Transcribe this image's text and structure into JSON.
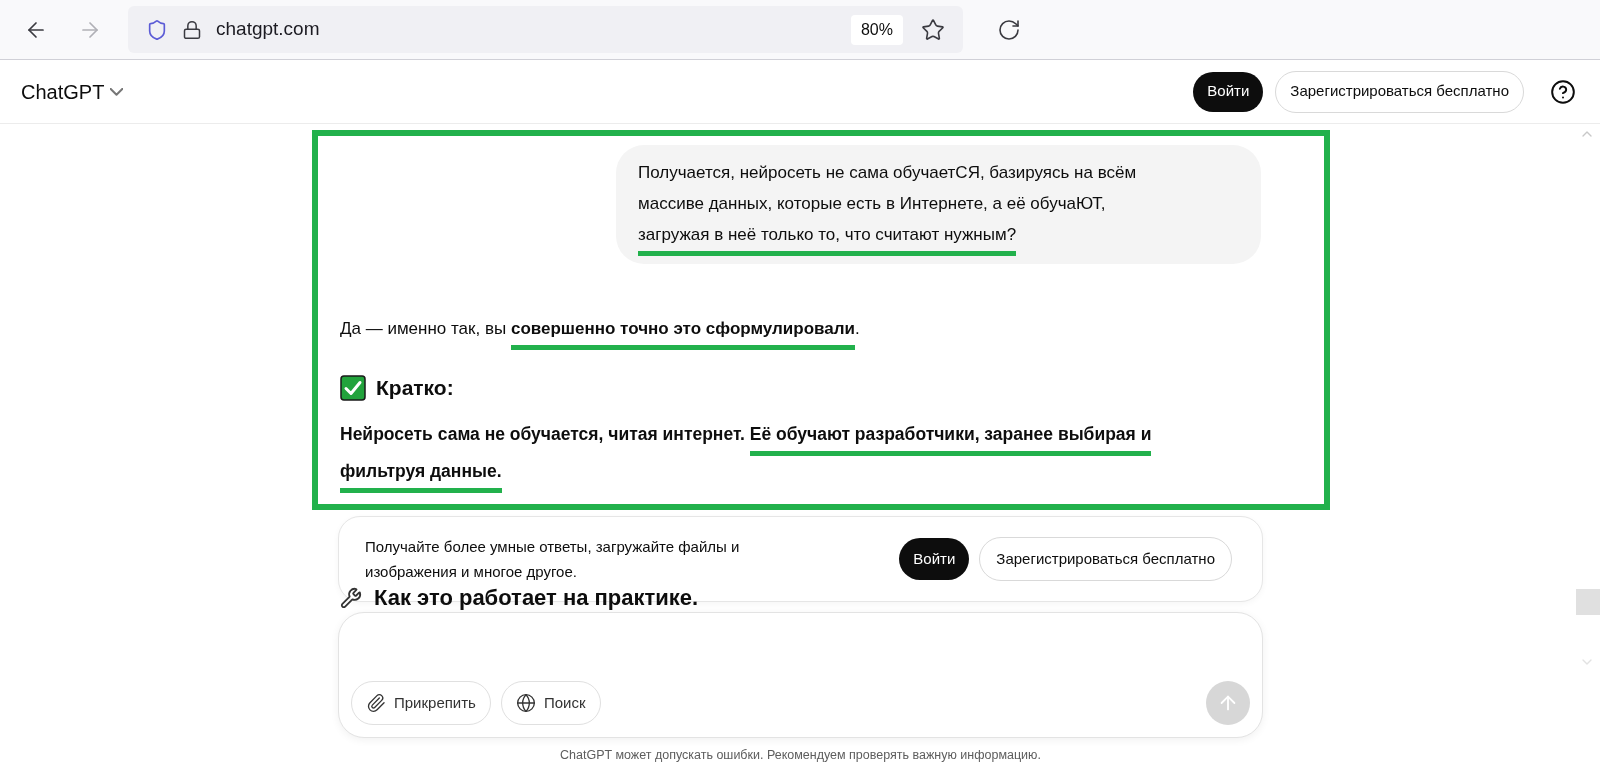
{
  "browser": {
    "back": {
      "disabled": false
    },
    "forward": {
      "disabled": true
    },
    "url": "chatgpt.com",
    "zoom": "80%"
  },
  "header": {
    "title": "ChatGPT",
    "login": "Войти",
    "signup": "Зарегистрироваться бесплатно"
  },
  "user_message": [
    {
      "text": "Получается, нейросеть не сама обучаетСЯ, базируясь на всём массиве данных, которые есть в Интернете, а её обучаЮТ, ",
      "underlined": false
    },
    {
      "text": "загружая в неё только то, что считают нужным?",
      "underlined": true
    }
  ],
  "answer": {
    "intro": [
      {
        "text": "Да — именно так, вы ",
        "bold": false,
        "underlined": false
      },
      {
        "text": "совершенно точно это сформулировали",
        "bold": true,
        "underlined": true
      },
      {
        "text": ".",
        "bold": false,
        "underlined": false
      }
    ],
    "heading": "Кратко:",
    "summary": [
      {
        "text": "Нейросеть сама не обучается, читая интернет. ",
        "bold": true,
        "underlined": false
      },
      {
        "text": "Её обучают разработчики, заранее выбирая и фильтруя данные.",
        "bold": true,
        "underlined": true
      }
    ],
    "next_heading": "Как это работает на практике."
  },
  "banner": {
    "text": "Получайте более умные ответы, загружайте файлы и изображения и многое другое.",
    "login": "Войти",
    "signup": "Зарегистрироваться бесплатно"
  },
  "composer": {
    "buttons": [
      {
        "kind": "attach",
        "label": "Прикрепить"
      },
      {
        "kind": "search",
        "label": "Поиск"
      }
    ],
    "send": {
      "disabled": true
    }
  },
  "footer_note": "ChatGPT может допускать ошибки. Рекомендуем проверять важную информацию."
}
